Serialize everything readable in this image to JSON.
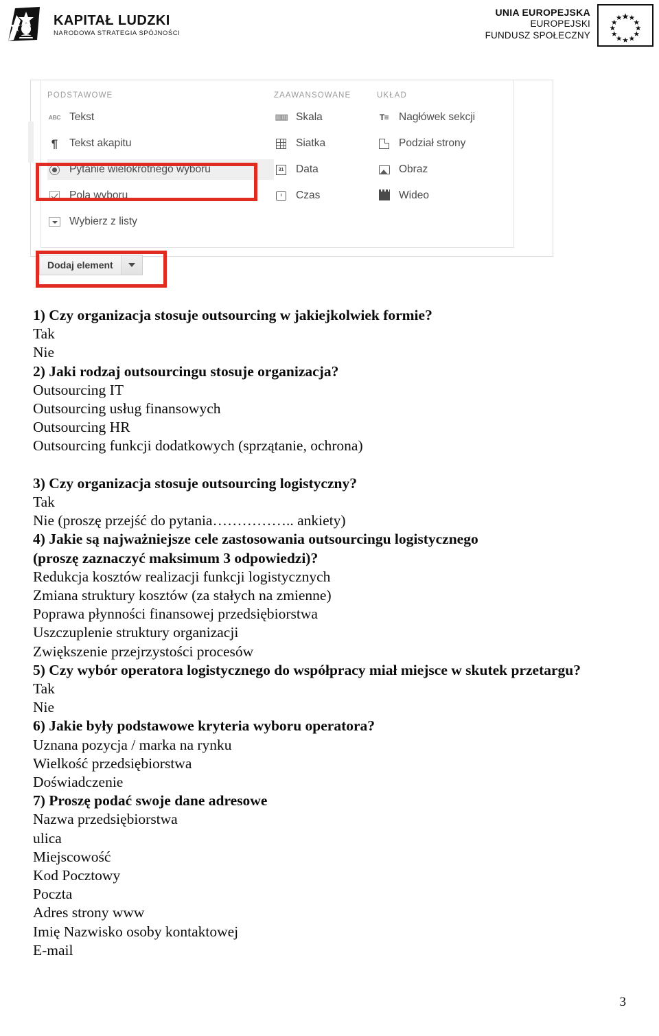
{
  "header": {
    "kapital_ludzki": {
      "title": "KAPITAŁ LUDZKI",
      "subtitle": "NARODOWA STRATEGIA SPÓJNOŚCI",
      "logo_icon": "kapital-ludzki-star-figure-logo"
    },
    "unia_europejska": {
      "line1": "UNIA EUROPEJSKA",
      "line2": "EUROPEJSKI",
      "line3": "FUNDUSZ SPOŁECZNY",
      "flag_icon": "eu-flag-twelve-stars"
    }
  },
  "screenshot": {
    "columns": [
      {
        "heading": "PODSTAWOWE",
        "items": [
          {
            "label": "Tekst",
            "icon": "abc-text-icon",
            "selected": false
          },
          {
            "label": "Tekst akapitu",
            "icon": "paragraph-pilcrow-icon",
            "selected": false
          },
          {
            "label": "Pytanie wielokrotnego wyboru",
            "icon": "radio-button-icon",
            "selected": true
          },
          {
            "label": "Pola wyboru",
            "icon": "checkbox-icon",
            "selected": false
          },
          {
            "label": "Wybierz z listy",
            "icon": "dropdown-icon",
            "selected": false
          }
        ]
      },
      {
        "heading": "ZAAWANSOWANE",
        "items": [
          {
            "label": "Skala",
            "icon": "scale-ruler-icon",
            "selected": false
          },
          {
            "label": "Siatka",
            "icon": "grid-icon",
            "selected": false
          },
          {
            "label": "Data",
            "icon": "calendar-date-icon",
            "selected": false
          },
          {
            "label": "Czas",
            "icon": "clock-time-icon",
            "selected": false
          }
        ]
      },
      {
        "heading": "UKŁAD",
        "items": [
          {
            "label": "Nagłówek sekcji",
            "icon": "section-header-icon",
            "selected": false
          },
          {
            "label": "Podział strony",
            "icon": "page-break-icon",
            "selected": false
          },
          {
            "label": "Obraz",
            "icon": "image-icon",
            "selected": false
          },
          {
            "label": "Wideo",
            "icon": "video-clapperboard-icon",
            "selected": false
          }
        ]
      }
    ],
    "add_button": {
      "label": "Dodaj element",
      "dropdown_icon": "chevron-down-icon"
    },
    "annotation_color": "#e02b20"
  },
  "document": {
    "lines": [
      {
        "text": "1) Czy organizacja stosuje outsourcing w jakiejkolwiek formie?",
        "bold": true
      },
      {
        "text": "Tak",
        "bold": false
      },
      {
        "text": "Nie",
        "bold": false
      },
      {
        "text": "2) Jaki rodzaj outsourcingu stosuje organizacja?",
        "bold": true
      },
      {
        "text": "Outsourcing IT",
        "bold": false
      },
      {
        "text": "Outsourcing usług finansowych",
        "bold": false
      },
      {
        "text": "Outsourcing HR",
        "bold": false
      },
      {
        "text": "Outsourcing funkcji dodatkowych (sprzątanie, ochrona)",
        "bold": false
      },
      {
        "text": "",
        "bold": false
      },
      {
        "text": "3) Czy organizacja stosuje outsourcing logistyczny?",
        "bold": true
      },
      {
        "text": "Tak",
        "bold": false
      },
      {
        "text": "Nie (proszę przejść do pytania…………….. ankiety)",
        "bold": false
      },
      {
        "text": "4) Jakie są najważniejsze cele zastosowania outsourcingu logistycznego",
        "bold": true
      },
      {
        "text": "(proszę zaznaczyć maksimum 3 odpowiedzi)?",
        "bold": true
      },
      {
        "text": "Redukcja kosztów realizacji funkcji logistycznych",
        "bold": false
      },
      {
        "text": "Zmiana struktury kosztów (za stałych na zmienne)",
        "bold": false
      },
      {
        "text": "Poprawa płynności finansowej przedsiębiorstwa",
        "bold": false
      },
      {
        "text": "Uszczuplenie struktury organizacji",
        "bold": false
      },
      {
        "text": "Zwiększenie przejrzystości procesów",
        "bold": false
      },
      {
        "text": "5) Czy wybór operatora logistycznego do współpracy miał miejsce w skutek przetargu?",
        "bold": true
      },
      {
        "text": "Tak",
        "bold": false
      },
      {
        "text": "Nie",
        "bold": false
      },
      {
        "text": "6) Jakie były podstawowe kryteria wyboru operatora?",
        "bold": true
      },
      {
        "text": "Uznana pozycja / marka na rynku",
        "bold": false
      },
      {
        "text": "Wielkość przedsiębiorstwa",
        "bold": false
      },
      {
        "text": "Doświadczenie",
        "bold": false
      },
      {
        "text": "7) Proszę podać swoje dane adresowe",
        "bold": true
      },
      {
        "text": "Nazwa przedsiębiorstwa",
        "bold": false
      },
      {
        "text": "ulica",
        "bold": false
      },
      {
        "text": "Miejscowość",
        "bold": false
      },
      {
        "text": "Kod Pocztowy",
        "bold": false
      },
      {
        "text": "Poczta",
        "bold": false
      },
      {
        "text": "Adres strony www",
        "bold": false
      },
      {
        "text": "Imię Nazwisko osoby kontaktowej",
        "bold": false
      },
      {
        "text": "E-mail",
        "bold": false
      }
    ]
  },
  "footer": {
    "page_number": "3"
  }
}
